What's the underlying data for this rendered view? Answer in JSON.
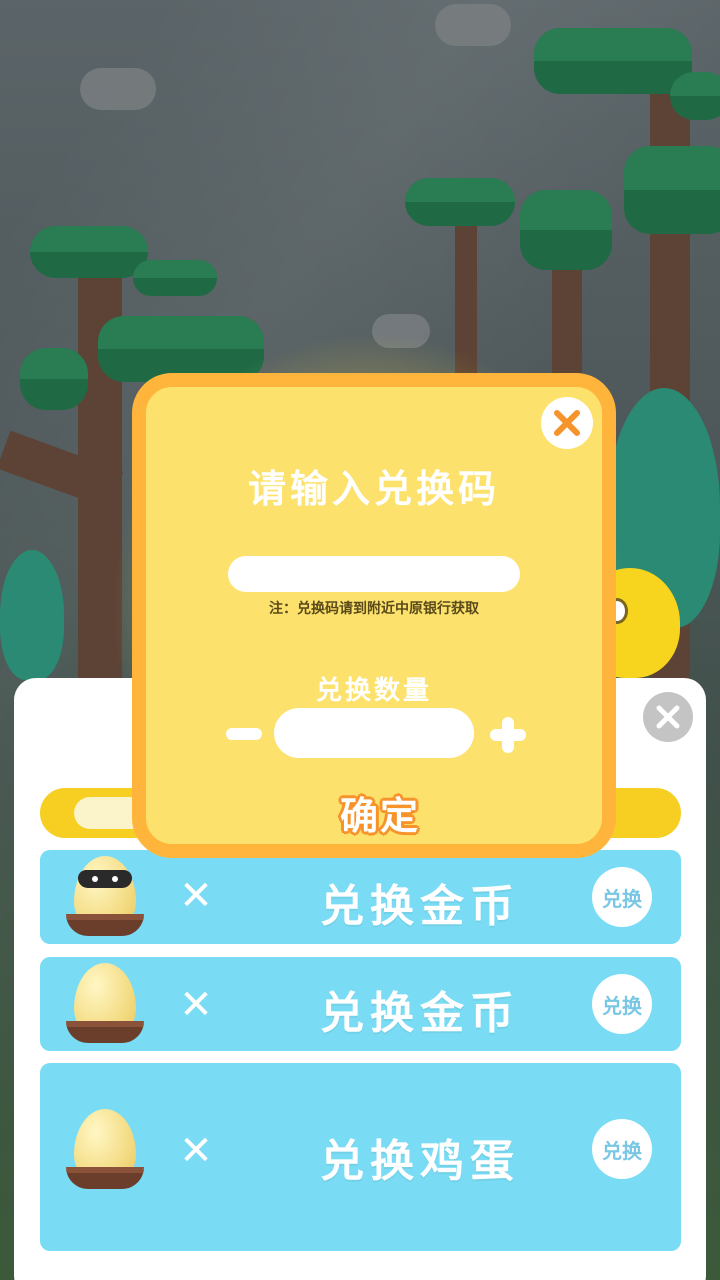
{
  "modal": {
    "title": "请输入兑换码",
    "code_input_value": "",
    "note": "注：兑换码请到附近中原银行获取",
    "quantity_label": "兑换数量",
    "quantity_value": "",
    "confirm_label": "确定"
  },
  "exchange_rows": [
    {
      "title": "兑换金币",
      "button_label": "兑换",
      "icon": "masked-egg-icon"
    },
    {
      "title": "兑换金币",
      "button_label": "兑换",
      "icon": "egg-icon"
    },
    {
      "title": "兑换鸡蛋",
      "button_label": "兑换",
      "icon": "egg-icon"
    }
  ],
  "multiply_symbol": "✕",
  "colors": {
    "modal_bg": "#fce26c",
    "modal_border": "#ffb53b",
    "row_bg": "#79dcf4",
    "confirm_outline": "#f6932a",
    "progress_bar": "#f6cf22"
  }
}
